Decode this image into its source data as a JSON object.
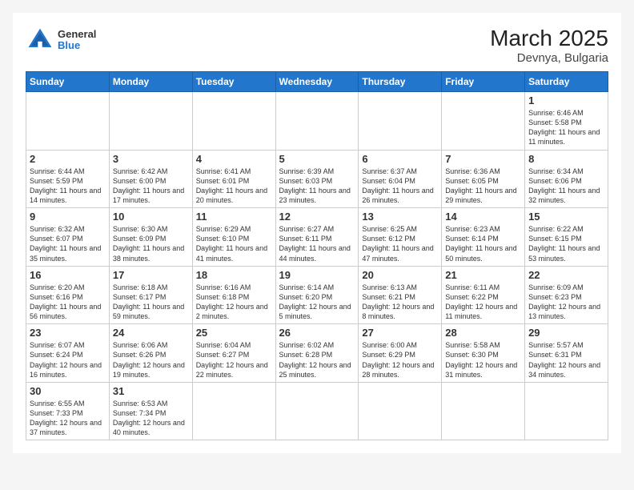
{
  "header": {
    "title": "March 2025",
    "subtitle": "Devnya, Bulgaria",
    "logo_general": "General",
    "logo_blue": "Blue"
  },
  "weekdays": [
    "Sunday",
    "Monday",
    "Tuesday",
    "Wednesday",
    "Thursday",
    "Friday",
    "Saturday"
  ],
  "weeks": [
    [
      {
        "day": null,
        "info": null
      },
      {
        "day": null,
        "info": null
      },
      {
        "day": null,
        "info": null
      },
      {
        "day": null,
        "info": null
      },
      {
        "day": null,
        "info": null
      },
      {
        "day": null,
        "info": null
      },
      {
        "day": "1",
        "info": "Sunrise: 6:46 AM\nSunset: 5:58 PM\nDaylight: 11 hours\nand 11 minutes."
      }
    ],
    [
      {
        "day": "2",
        "info": "Sunrise: 6:44 AM\nSunset: 5:59 PM\nDaylight: 11 hours\nand 14 minutes."
      },
      {
        "day": "3",
        "info": "Sunrise: 6:42 AM\nSunset: 6:00 PM\nDaylight: 11 hours\nand 17 minutes."
      },
      {
        "day": "4",
        "info": "Sunrise: 6:41 AM\nSunset: 6:01 PM\nDaylight: 11 hours\nand 20 minutes."
      },
      {
        "day": "5",
        "info": "Sunrise: 6:39 AM\nSunset: 6:03 PM\nDaylight: 11 hours\nand 23 minutes."
      },
      {
        "day": "6",
        "info": "Sunrise: 6:37 AM\nSunset: 6:04 PM\nDaylight: 11 hours\nand 26 minutes."
      },
      {
        "day": "7",
        "info": "Sunrise: 6:36 AM\nSunset: 6:05 PM\nDaylight: 11 hours\nand 29 minutes."
      },
      {
        "day": "8",
        "info": "Sunrise: 6:34 AM\nSunset: 6:06 PM\nDaylight: 11 hours\nand 32 minutes."
      }
    ],
    [
      {
        "day": "9",
        "info": "Sunrise: 6:32 AM\nSunset: 6:07 PM\nDaylight: 11 hours\nand 35 minutes."
      },
      {
        "day": "10",
        "info": "Sunrise: 6:30 AM\nSunset: 6:09 PM\nDaylight: 11 hours\nand 38 minutes."
      },
      {
        "day": "11",
        "info": "Sunrise: 6:29 AM\nSunset: 6:10 PM\nDaylight: 11 hours\nand 41 minutes."
      },
      {
        "day": "12",
        "info": "Sunrise: 6:27 AM\nSunset: 6:11 PM\nDaylight: 11 hours\nand 44 minutes."
      },
      {
        "day": "13",
        "info": "Sunrise: 6:25 AM\nSunset: 6:12 PM\nDaylight: 11 hours\nand 47 minutes."
      },
      {
        "day": "14",
        "info": "Sunrise: 6:23 AM\nSunset: 6:14 PM\nDaylight: 11 hours\nand 50 minutes."
      },
      {
        "day": "15",
        "info": "Sunrise: 6:22 AM\nSunset: 6:15 PM\nDaylight: 11 hours\nand 53 minutes."
      }
    ],
    [
      {
        "day": "16",
        "info": "Sunrise: 6:20 AM\nSunset: 6:16 PM\nDaylight: 11 hours\nand 56 minutes."
      },
      {
        "day": "17",
        "info": "Sunrise: 6:18 AM\nSunset: 6:17 PM\nDaylight: 11 hours\nand 59 minutes."
      },
      {
        "day": "18",
        "info": "Sunrise: 6:16 AM\nSunset: 6:18 PM\nDaylight: 12 hours\nand 2 minutes."
      },
      {
        "day": "19",
        "info": "Sunrise: 6:14 AM\nSunset: 6:20 PM\nDaylight: 12 hours\nand 5 minutes."
      },
      {
        "day": "20",
        "info": "Sunrise: 6:13 AM\nSunset: 6:21 PM\nDaylight: 12 hours\nand 8 minutes."
      },
      {
        "day": "21",
        "info": "Sunrise: 6:11 AM\nSunset: 6:22 PM\nDaylight: 12 hours\nand 11 minutes."
      },
      {
        "day": "22",
        "info": "Sunrise: 6:09 AM\nSunset: 6:23 PM\nDaylight: 12 hours\nand 13 minutes."
      }
    ],
    [
      {
        "day": "23",
        "info": "Sunrise: 6:07 AM\nSunset: 6:24 PM\nDaylight: 12 hours\nand 16 minutes."
      },
      {
        "day": "24",
        "info": "Sunrise: 6:06 AM\nSunset: 6:26 PM\nDaylight: 12 hours\nand 19 minutes."
      },
      {
        "day": "25",
        "info": "Sunrise: 6:04 AM\nSunset: 6:27 PM\nDaylight: 12 hours\nand 22 minutes."
      },
      {
        "day": "26",
        "info": "Sunrise: 6:02 AM\nSunset: 6:28 PM\nDaylight: 12 hours\nand 25 minutes."
      },
      {
        "day": "27",
        "info": "Sunrise: 6:00 AM\nSunset: 6:29 PM\nDaylight: 12 hours\nand 28 minutes."
      },
      {
        "day": "28",
        "info": "Sunrise: 5:58 AM\nSunset: 6:30 PM\nDaylight: 12 hours\nand 31 minutes."
      },
      {
        "day": "29",
        "info": "Sunrise: 5:57 AM\nSunset: 6:31 PM\nDaylight: 12 hours\nand 34 minutes."
      }
    ],
    [
      {
        "day": "30",
        "info": "Sunrise: 6:55 AM\nSunset: 7:33 PM\nDaylight: 12 hours\nand 37 minutes."
      },
      {
        "day": "31",
        "info": "Sunrise: 6:53 AM\nSunset: 7:34 PM\nDaylight: 12 hours\nand 40 minutes."
      },
      {
        "day": null,
        "info": null
      },
      {
        "day": null,
        "info": null
      },
      {
        "day": null,
        "info": null
      },
      {
        "day": null,
        "info": null
      },
      {
        "day": null,
        "info": null
      }
    ]
  ]
}
